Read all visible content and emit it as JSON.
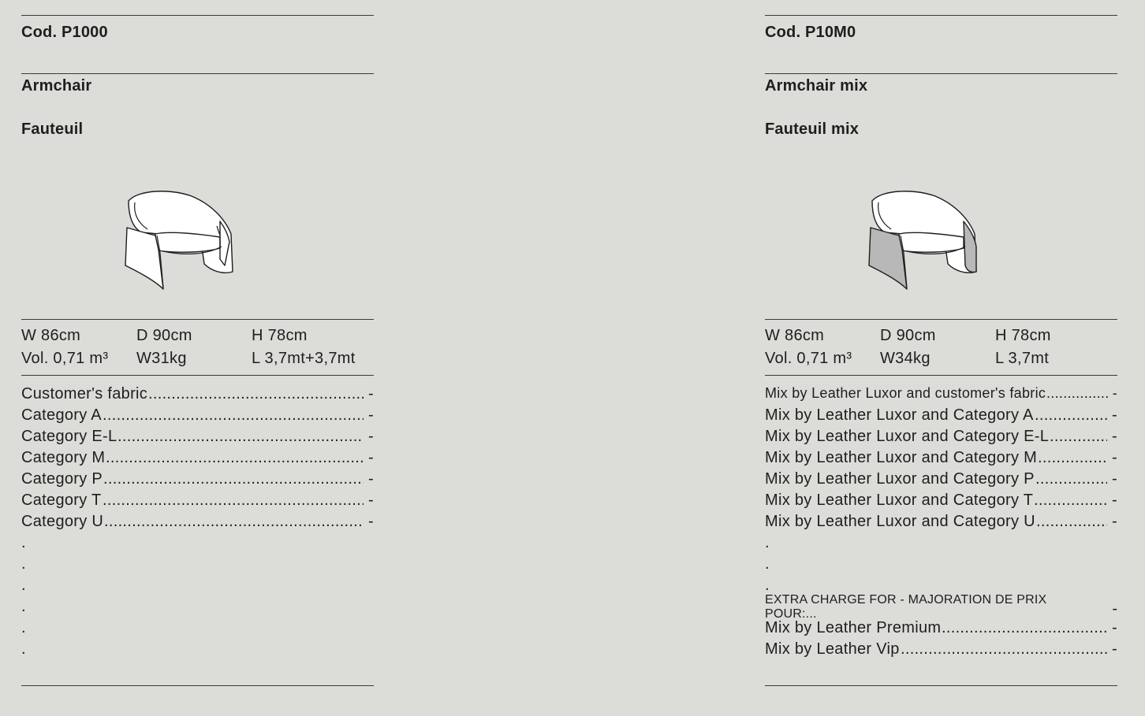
{
  "left": {
    "code": "Cod. P1000",
    "name_en": "Armchair",
    "name_fr": "Fauteuil",
    "illustration_icon": "armchair-line-drawing",
    "dims": {
      "w": "W 86cm",
      "d": "D 90cm",
      "h": "H 78cm",
      "vol": "Vol. 0,71 m³",
      "weight": "W31kg",
      "length": "L 3,7mt+3,7mt"
    },
    "prices": [
      {
        "label": "Customer's fabric",
        "value": "-"
      },
      {
        "label": "Category A",
        "value": "-"
      },
      {
        "label": "Category E-L",
        "value": "-"
      },
      {
        "label": "Category M",
        "value": "-"
      },
      {
        "label": "Category P",
        "value": "-"
      },
      {
        "label": "Category T",
        "value": "-"
      },
      {
        "label": "Category U",
        "value": "-"
      }
    ],
    "dots": [
      ".",
      ".",
      ".",
      ".",
      ".",
      "."
    ]
  },
  "right": {
    "code": "Cod. P10M0",
    "name_en": "Armchair mix",
    "name_fr": "Fauteuil mix",
    "illustration_icon": "armchair-mix-line-drawing",
    "dims": {
      "w": "W 86cm",
      "d": "D 90cm",
      "h": "H 78cm",
      "vol": "Vol. 0,71 m³",
      "weight": "W34kg",
      "length": "L 3,7mt"
    },
    "prices": [
      {
        "label": "Mix by Leather Luxor and customer's fabric",
        "value": "-"
      },
      {
        "label": "Mix by Leather Luxor and Category A",
        "value": "-"
      },
      {
        "label": "Mix by Leather Luxor and Category E-L",
        "value": "-"
      },
      {
        "label": "Mix by Leather Luxor and Category M",
        "value": "-"
      },
      {
        "label": "Mix by Leather Luxor and Category P",
        "value": "-"
      },
      {
        "label": "Mix by Leather Luxor and Category T",
        "value": "-"
      },
      {
        "label": "Mix by Leather Luxor and Category U",
        "value": "-"
      }
    ],
    "dots": [
      ".",
      ".",
      "."
    ],
    "extra_charge": {
      "label": "EXTRA CHARGE FOR - MAJORATION DE PRIX POUR:...",
      "value": "-"
    },
    "extra_prices": [
      {
        "label": "Mix by Leather Premium",
        "value": "-"
      },
      {
        "label": "Mix by Leather Vip",
        "value": "-"
      }
    ]
  },
  "colors": {
    "background": "#dcdcd8",
    "text": "#1e1e1e",
    "rule": "#3a3a3a",
    "mix_panel": "#b8b8b8"
  }
}
